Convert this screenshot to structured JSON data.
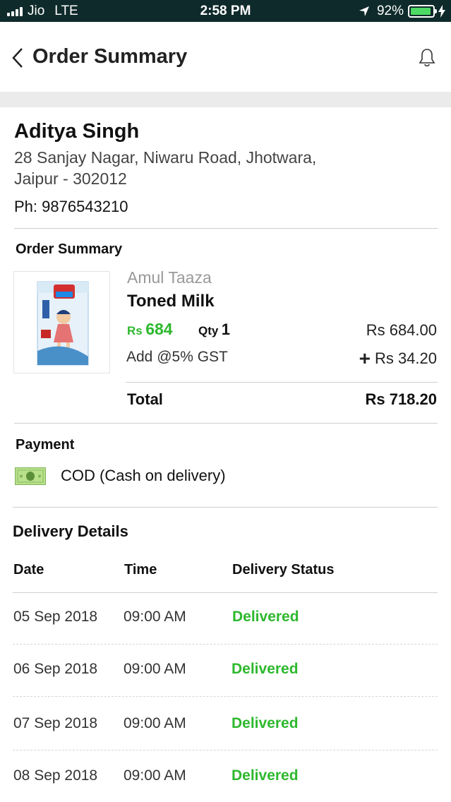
{
  "status_bar": {
    "carrier": "Jio",
    "network": "LTE",
    "time": "2:58 PM",
    "battery": "92%",
    "battery_level": 0.92,
    "battery_color": "#4cd964"
  },
  "header": {
    "title": "Order Summary",
    "back_icon": "chevron-left-icon",
    "notification_icon": "bell-icon"
  },
  "customer": {
    "name": "Aditya Singh",
    "address": "28 Sanjay Nagar, Niwaru Road, Jhotwara, Jaipur - 302012",
    "phone": "Ph: 9876543210"
  },
  "order": {
    "section_title": "Order Summary",
    "product": {
      "brand": "Amul Taaza",
      "name": "Toned Milk",
      "price_currency": "Rs",
      "price_value": "684",
      "qty_label": "Qty",
      "qty_value": "1",
      "line_amount": "Rs 684.00",
      "gst_label": "Add @5% GST",
      "gst_amount": "Rs 34.20"
    },
    "total_label": "Total",
    "total_amount": "Rs 718.20"
  },
  "payment": {
    "section_title": "Payment",
    "method": "COD (Cash on delivery)",
    "icon": "cash-icon"
  },
  "delivery": {
    "section_title": "Delivery Details",
    "columns": [
      "Date",
      "Time",
      "Delivery Status"
    ],
    "rows": [
      {
        "date": "05 Sep 2018",
        "time": "09:00 AM",
        "status": "Delivered"
      },
      {
        "date": "06 Sep 2018",
        "time": "09:00 AM",
        "status": "Delivered"
      },
      {
        "date": "07 Sep 2018",
        "time": "09:00 AM",
        "status": "Delivered"
      },
      {
        "date": "08 Sep 2018",
        "time": "09:00 AM",
        "status": "Delivered"
      }
    ]
  },
  "colors": {
    "accent_green": "#2eb82e",
    "status_bar_bg": "#0f2a2a"
  }
}
